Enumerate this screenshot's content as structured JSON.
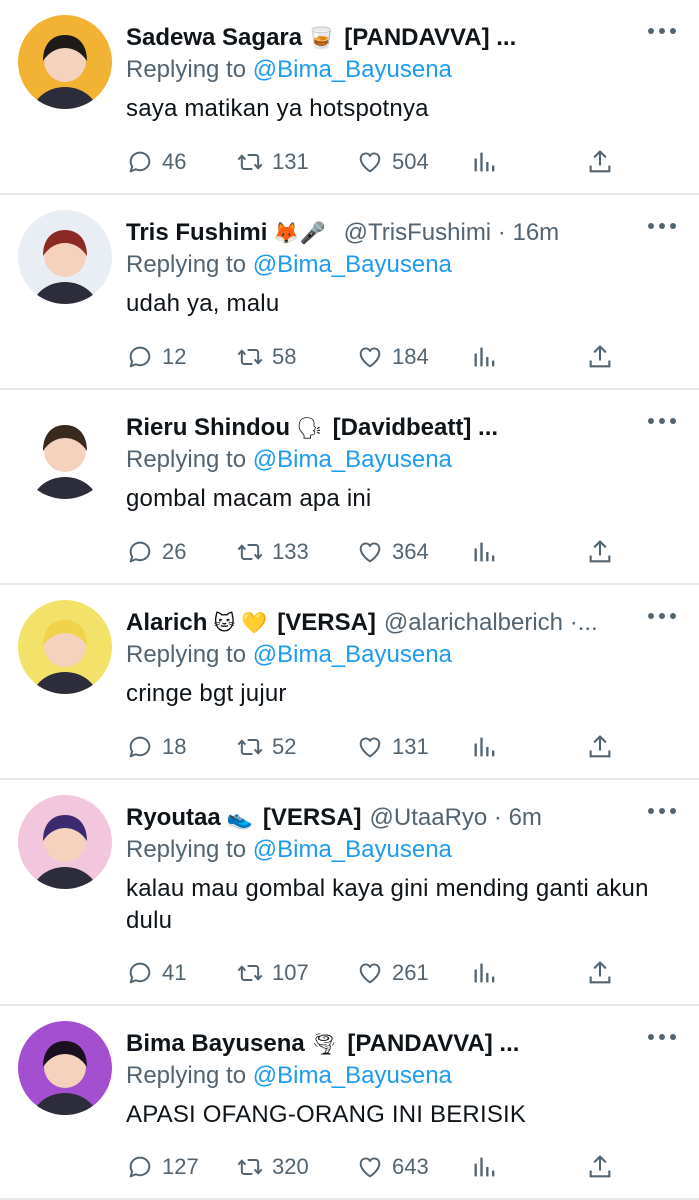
{
  "tweets": [
    {
      "name": "Sadewa Sagara",
      "emoji": "🥃",
      "tag": "[PANDAVVA] ...",
      "handle": "",
      "reply_prefix": "Replying to",
      "reply_to": "@Bima_Bayusena",
      "text": "saya matikan ya hotspotnya",
      "replies": "46",
      "retweets": "131",
      "likes": "504",
      "avatar_bg": "#f2b233"
    },
    {
      "name": "Tris Fushimi",
      "emoji": "🦊🎤",
      "tag": "",
      "handle": "@TrisFushimi · 16m",
      "reply_prefix": "Replying to",
      "reply_to": "@Bima_Bayusena",
      "text": "udah ya, malu",
      "replies": "12",
      "retweets": "58",
      "likes": "184",
      "avatar_bg": "#e9eef5"
    },
    {
      "name": "Rieru Shindou",
      "emoji": "🗣",
      "tag": "[Davidbeatt] ...",
      "handle": "",
      "reply_prefix": "Replying to",
      "reply_to": "@Bima_Bayusena",
      "text": "gombal macam apa ini",
      "replies": "26",
      "retweets": "133",
      "likes": "364",
      "avatar_bg": "#ffffff"
    },
    {
      "name": "Alarich",
      "emoji": "🐱 💛",
      "tag": "[VERSA]",
      "handle": "@alarichalberich ·...",
      "reply_prefix": "Replying to",
      "reply_to": "@Bima_Bayusena",
      "text": "cringe bgt jujur",
      "replies": "18",
      "retweets": "52",
      "likes": "131",
      "avatar_bg": "#f3e26a"
    },
    {
      "name": "Ryoutaa",
      "emoji": "👟",
      "tag": "[VERSA]",
      "handle": "@UtaaRyo · 6m",
      "reply_prefix": "Replying to",
      "reply_to": "@Bima_Bayusena",
      "text": "kalau mau gombal kaya gini mending ganti akun dulu",
      "replies": "41",
      "retweets": "107",
      "likes": "261",
      "avatar_bg": "#f2c6dc"
    },
    {
      "name": "Bima Bayusena",
      "emoji": "🌪",
      "tag": "[PANDAVVA] ...",
      "handle": "",
      "reply_prefix": "Replying to",
      "reply_to": "@Bima_Bayusena",
      "text": "APASI OFANG-ORANG INI BERISIK",
      "replies": "127",
      "retweets": "320",
      "likes": "643",
      "avatar_bg": "#a34fd0"
    }
  ],
  "colors": {
    "link": "#1d9bf0",
    "muted": "#536471",
    "divider": "#e8e8ea"
  },
  "icons": [
    "reply-icon",
    "retweet-icon",
    "like-icon",
    "stats-icon",
    "share-icon",
    "more-icon"
  ]
}
